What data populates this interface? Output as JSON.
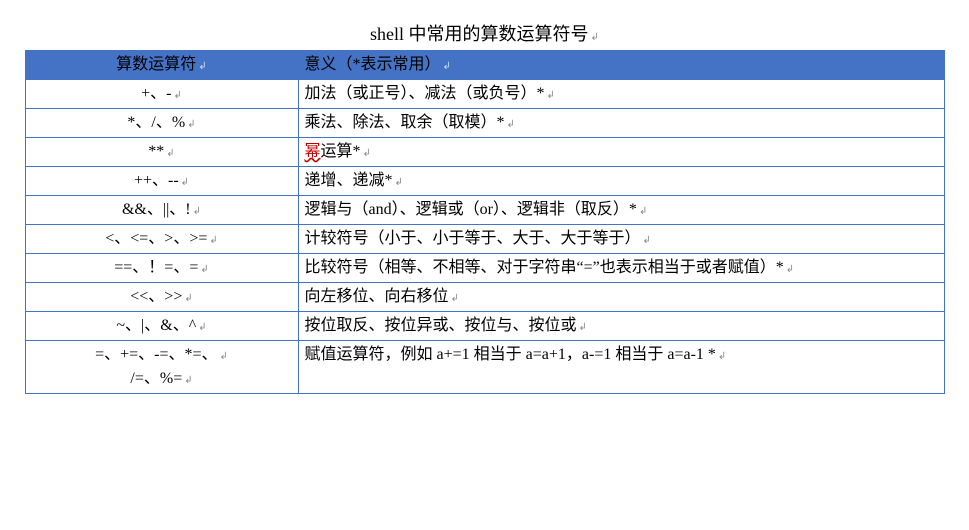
{
  "title": "shell 中常用的算数运算符号",
  "para": "↲",
  "headers": {
    "col1": "算数运算符",
    "col2": "意义（*表示常用）"
  },
  "rows": [
    {
      "op": "+、-",
      "desc": "加法（或正号）、减法（或负号）*"
    },
    {
      "op": "*、/、%",
      "desc": "乘法、除法、取余（取模）*"
    },
    {
      "op": "**",
      "desc_prefix": "幂",
      "desc_suffix": "运算*"
    },
    {
      "op": "++、--",
      "desc": "递增、递减*"
    },
    {
      "op": "&&、||、!",
      "desc": "逻辑与（and）、逻辑或（or）、逻辑非（取反）*"
    },
    {
      "op": "<、<=、>、>=",
      "desc": "计较符号（小于、小于等于、大于、大于等于）"
    },
    {
      "op": "==、！=、=",
      "desc": "比较符号（相等、不相等、对于字符串“=”也表示相当于或者赋值）*"
    },
    {
      "op": "<<、>>",
      "desc": "向左移位、向右移位"
    },
    {
      "op": "~、|、&、^",
      "desc": "按位取反、按位异或、按位与、按位或"
    },
    {
      "op_line1": "=、+=、-=、*=、",
      "op_line2": "/=、%=",
      "desc": "赋值运算符，例如 a+=1 相当于 a=a+1，a-=1 相当于 a=a-1 *"
    }
  ]
}
